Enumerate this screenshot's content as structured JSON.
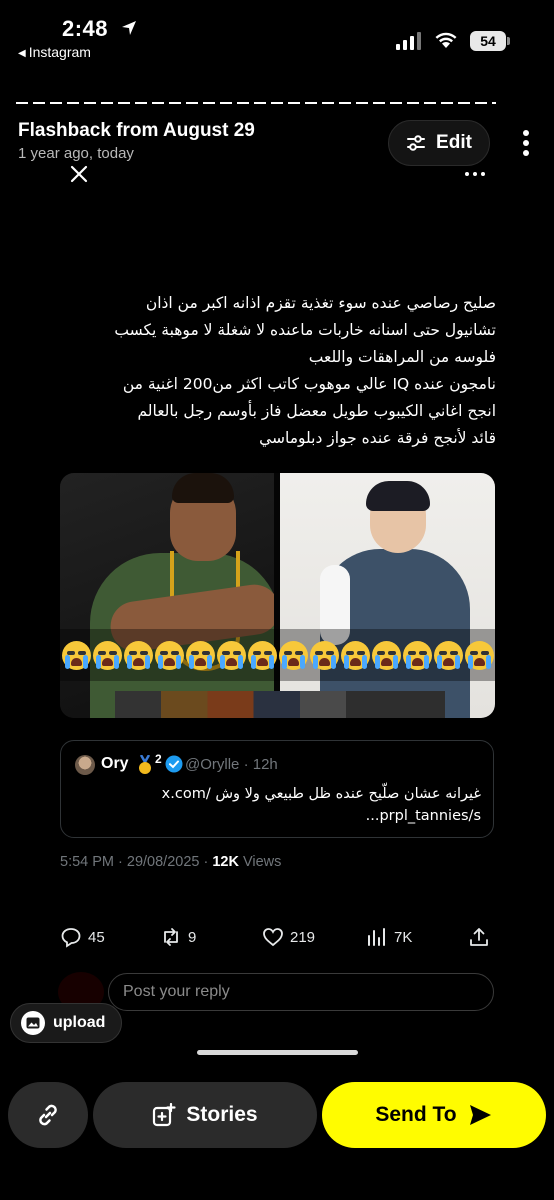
{
  "status_bar": {
    "time": "2:48",
    "back_app": "Instagram",
    "battery": "54"
  },
  "flashback": {
    "title": "Flashback from August 29",
    "subtitle": "1 year ago, today",
    "edit_label": "Edit"
  },
  "tweet": {
    "text": "صليح  رصاصي عنده سوء تغذية تقزم اذانه اكبر من اذان\nتشانيول حتى اسنانه خاربات ماعنده لا شغلة لا موهبة يكسب\nفلوسه من المراهقات واللعب\nنامجون عنده IQ عالي موهوب كاتب اكثر من200 اغنية من\nانجح اغاني الكيبوب طويل معضل فاز بأوسم رجل بالعالم\nقائد لأنجح فرقة عنده جواز دبلوماسي",
    "emoji_count": 14,
    "quote": {
      "name": "Ory",
      "badge_num": "2",
      "handle": "@Orylle · 12h",
      "text": "غيرانه عشان صلّيح عنده ظل طبيعي ولا وش /x.com\nprpl_tannies/s..."
    },
    "meta_time": "5:54 PM · 29/08/2025 · ",
    "meta_views_count": "12K",
    "meta_views_label": " Views",
    "actions": {
      "replies": "45",
      "reposts": "9",
      "likes": "219",
      "views": "7K"
    },
    "reply_placeholder": "Post your reply"
  },
  "upload_label": "upload",
  "bottom_bar": {
    "stories_label": "Stories",
    "send_label": "Send To"
  },
  "colors": {
    "background": "#000000",
    "send_button": "#fffc00",
    "muted_text": "#71767b",
    "verified_blue": "#1d9bf0"
  }
}
